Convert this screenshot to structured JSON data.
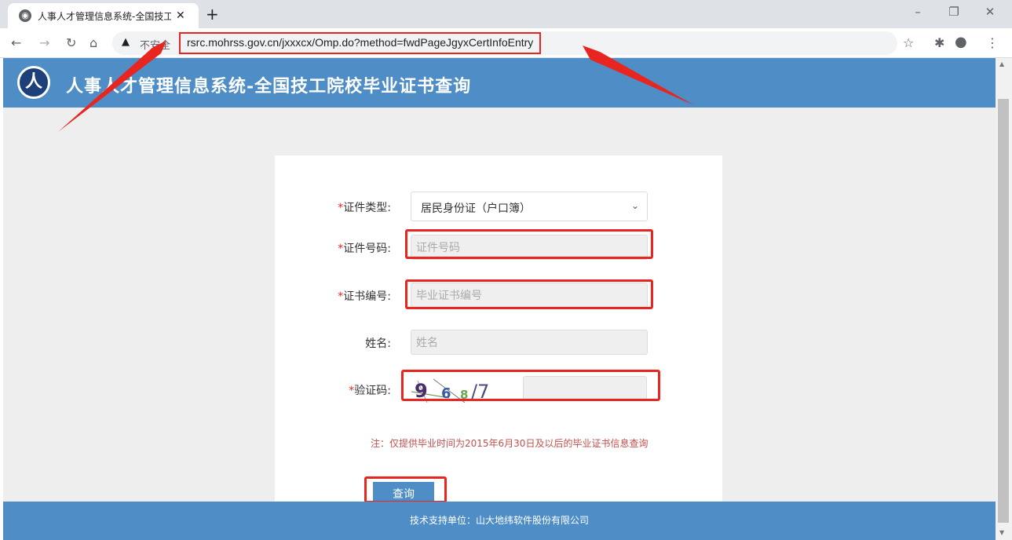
{
  "browser": {
    "tab_title": "人事人才管理信息系统-全国技工院",
    "tab_close": "✕",
    "new_tab": "+",
    "security_label": "不安全",
    "url": "rsrc.mohrss.gov.cn/jxxxcx/Omp.do?method=fwdPageJgyxCertInfoEntry",
    "icons": [
      "back-icon",
      "forward-icon",
      "reload-icon",
      "home-icon",
      "warning-icon",
      "star-icon",
      "extensions-icon",
      "profile-icon",
      "menu-icon"
    ]
  },
  "header": {
    "logo_text": "人",
    "title": "人事人才管理信息系统-全国技工院校毕业证书查询"
  },
  "form": {
    "required_mark": "*",
    "cert_type_label": "证件类型:",
    "cert_type_value": "居民身份证（户口簿）",
    "id_label": "证件号码:",
    "id_placeholder": "证件号码",
    "cert_no_label": "证书编号:",
    "cert_no_placeholder": "毕业证书编号",
    "name_label": "姓名:",
    "name_placeholder": "姓名",
    "captcha_label": "验证码:",
    "captcha_chars": [
      "9",
      "6",
      "8",
      "/7"
    ],
    "note": "注：仅提供毕业时间为2015年6月30日及以后的毕业证书信息查询",
    "submit_label": "查询"
  },
  "footer": {
    "text": "技术支持单位：山大地纬软件股份有限公司"
  },
  "colors": {
    "header_blue": "#4e8dc6",
    "annotation_red": "#e8251f",
    "note_red": "#c0504d"
  }
}
